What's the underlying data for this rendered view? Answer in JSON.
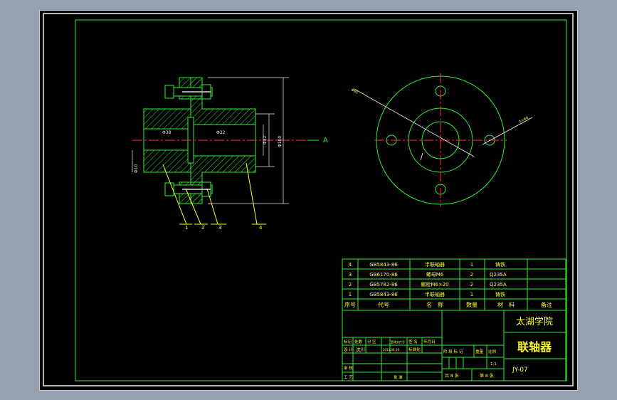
{
  "drawing": {
    "view_label": "A",
    "dims": {
      "d_left": "Φ38",
      "d_right": "Φ32",
      "bore_a": "Φ32",
      "bore_b": "Φ100",
      "hole_small": "Φ10",
      "bolt_circle": "Φ85",
      "bolt_hole": "4×Φ6"
    },
    "callouts": [
      "1",
      "2",
      "3",
      "4"
    ]
  },
  "parts_table": {
    "header": {
      "no": "序号",
      "code": "代号",
      "name": "名　称",
      "qty": "数量",
      "material": "材　料",
      "remark": "备注"
    },
    "rows": [
      {
        "no": "4",
        "code": "GB5843-86",
        "name": "半联轴器",
        "qty": "1",
        "material": "铸铁"
      },
      {
        "no": "3",
        "code": "GB6170-86",
        "name": "螺母M6",
        "qty": "2",
        "material": "Q235A"
      },
      {
        "no": "2",
        "code": "GB5782-86",
        "name": "螺栓M6×20",
        "qty": "2",
        "material": "Q235A"
      },
      {
        "no": "1",
        "code": "GB5843-86",
        "name": "半联轴器",
        "qty": "1",
        "material": "铸铁"
      }
    ]
  },
  "title_block": {
    "school": "太湖学院",
    "drawing_name": "联轴器",
    "drawing_no": "JY-07",
    "mark_row": [
      "标记",
      "处数",
      "分 区",
      "更改文件号",
      "签 名",
      "年月日"
    ],
    "design_label": "设 计",
    "designer": "沈川",
    "design_date": "2013.06.18",
    "standardize": "标准化",
    "stage_labels": [
      "阶 段 标 记",
      "重量",
      "比例"
    ],
    "scale": "1:1",
    "review": "审 核",
    "process": "工 艺",
    "approve": "批 准",
    "sheets_total": "共 8 张",
    "sheet_no": "第 8 张"
  }
}
